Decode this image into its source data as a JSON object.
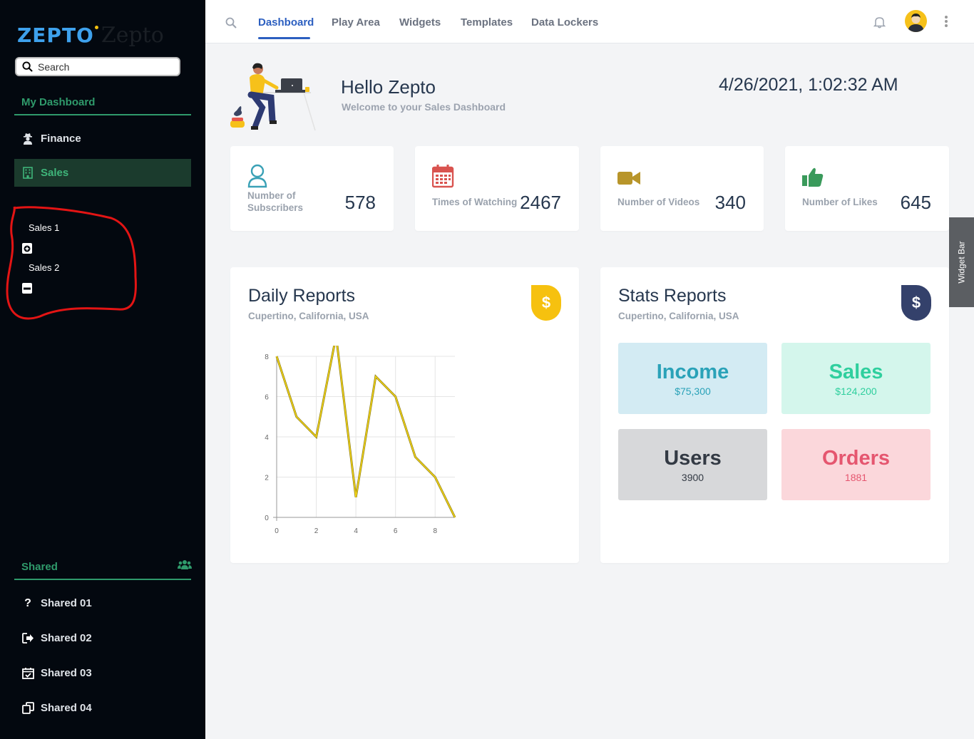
{
  "sidebar": {
    "logo_text": "ZEPTO",
    "logo_ghost": "Zepto",
    "search_placeholder": "Search",
    "my_dashboard": "My Dashboard",
    "items": [
      {
        "label": "Finance",
        "icon": "user-secret-icon"
      },
      {
        "label": "Sales",
        "icon": "building-icon",
        "active": true
      }
    ],
    "sub_items": [
      {
        "label": "Sales 1",
        "toggle": "plus-square-icon"
      },
      {
        "label": "Sales 2",
        "toggle": "minus-square-icon"
      }
    ],
    "shared_title": "Shared",
    "shared_items": [
      {
        "label": "Shared 01",
        "icon": "question-icon"
      },
      {
        "label": "Shared 02",
        "icon": "sign-out-icon"
      },
      {
        "label": "Shared 03",
        "icon": "calendar-check-icon"
      },
      {
        "label": "Shared 04",
        "icon": "copy-icon"
      }
    ],
    "accent": "#2f9a6b"
  },
  "topbar": {
    "tabs": [
      "Dashboard",
      "Play Area",
      "Widgets",
      "Templates",
      "Data Lockers"
    ],
    "active_tab": "Dashboard",
    "accent": "#2c5fc0"
  },
  "header": {
    "greeting": "Hello Zepto",
    "subtitle": "Welcome to your Sales Dashboard",
    "datetime": "4/26/2021, 1:02:32 AM"
  },
  "stats": [
    {
      "label_line1": "Number of",
      "label_line2": "Subscribers",
      "value": "578",
      "icon": "user-icon",
      "color": "#3aa1b6"
    },
    {
      "label_line1": "Times of Watching",
      "label_line2": "",
      "value": "2467",
      "icon": "calendar-icon",
      "color": "#d9534f"
    },
    {
      "label_line1": "Number of Videos",
      "label_line2": "",
      "value": "340",
      "icon": "video-icon",
      "color": "#b8952a"
    },
    {
      "label_line1": "Number of Likes",
      "label_line2": "",
      "value": "645",
      "icon": "thumbs-up-icon",
      "color": "#3a9a5b"
    }
  ],
  "widget_bar_label": "Widget Bar",
  "daily_reports": {
    "title": "Daily Reports",
    "location": "Cupertino, California, USA",
    "badge": "$",
    "badge_color": "#f6c10f"
  },
  "stats_reports": {
    "title": "Stats Reports",
    "location": "Cupertino, California, USA",
    "badge": "$",
    "badge_color": "#34416b",
    "tiles": [
      {
        "name": "Income",
        "value": "$75,300",
        "bg": "#d3ebf3",
        "fg": "#2aa2b8"
      },
      {
        "name": "Sales",
        "value": "$124,200",
        "bg": "#d4f6ec",
        "fg": "#2fcf9e"
      },
      {
        "name": "Users",
        "value": "3900",
        "bg": "#d7d8da",
        "fg": "#333a44"
      },
      {
        "name": "Orders",
        "value": "1881",
        "bg": "#fbd7db",
        "fg": "#e5566f"
      }
    ]
  },
  "chart_data": {
    "type": "line",
    "title": "",
    "xlabel": "",
    "ylabel": "",
    "x": [
      0,
      1,
      2,
      3,
      4,
      5,
      6,
      7,
      8,
      9
    ],
    "series": [
      {
        "values": [
          8,
          5,
          4,
          9,
          1,
          7,
          6,
          3,
          2,
          0
        ]
      }
    ],
    "xticks": [
      0,
      2,
      4,
      6,
      8
    ],
    "yticks": [
      0,
      2,
      4,
      6,
      8
    ],
    "xlim": [
      0,
      9
    ],
    "ylim": [
      0,
      8
    ],
    "grid": true,
    "line_color": "#f2d417"
  }
}
